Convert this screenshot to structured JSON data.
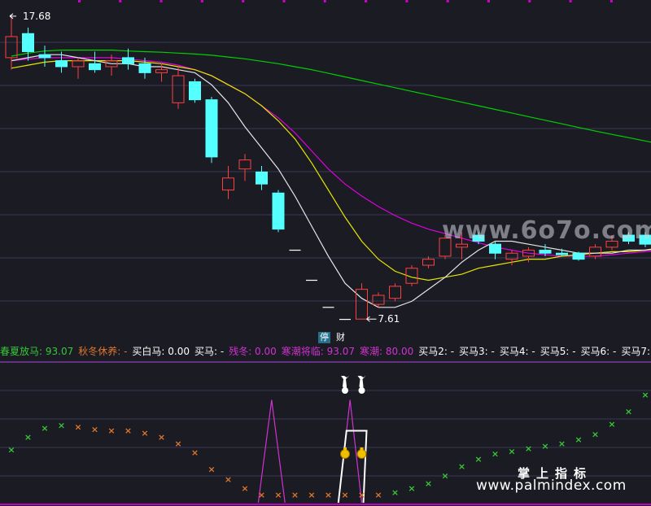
{
  "chart_data": [
    {
      "type": "candlestick",
      "title": "",
      "price_range": [
        7.4,
        18.0
      ],
      "grid": true,
      "high_label": "17.68",
      "low_label": "7.61",
      "candles": [
        {
          "o": 16.3,
          "h": 17.68,
          "l": 15.9,
          "c": 17.0
        },
        {
          "o": 17.1,
          "h": 17.3,
          "l": 16.2,
          "c": 16.5
        },
        {
          "o": 16.4,
          "h": 16.7,
          "l": 16.0,
          "c": 16.3
        },
        {
          "o": 16.2,
          "h": 16.5,
          "l": 15.8,
          "c": 16.0
        },
        {
          "o": 16.0,
          "h": 16.3,
          "l": 15.6,
          "c": 16.2
        },
        {
          "o": 16.1,
          "h": 16.5,
          "l": 15.8,
          "c": 15.9
        },
        {
          "o": 16.0,
          "h": 16.4,
          "l": 15.7,
          "c": 16.2
        },
        {
          "o": 16.3,
          "h": 16.6,
          "l": 15.9,
          "c": 16.1
        },
        {
          "o": 16.1,
          "h": 16.3,
          "l": 15.6,
          "c": 15.8
        },
        {
          "o": 15.8,
          "h": 16.1,
          "l": 15.5,
          "c": 15.9
        },
        {
          "o": 14.8,
          "h": 16.0,
          "l": 14.6,
          "c": 15.7
        },
        {
          "o": 15.5,
          "h": 15.6,
          "l": 14.8,
          "c": 14.9
        },
        {
          "o": 14.9,
          "h": 15.0,
          "l": 12.8,
          "c": 13.0
        },
        {
          "o": 11.9,
          "h": 12.7,
          "l": 11.6,
          "c": 12.3
        },
        {
          "o": 12.6,
          "h": 13.1,
          "l": 12.2,
          "c": 12.9
        },
        {
          "o": 12.5,
          "h": 12.7,
          "l": 11.9,
          "c": 12.1
        },
        {
          "o": 11.8,
          "h": 11.9,
          "l": 10.5,
          "c": 10.6
        },
        {
          "o": 9.9,
          "h": 9.9,
          "l": 9.9,
          "c": 9.9
        },
        {
          "o": 8.9,
          "h": 8.9,
          "l": 8.9,
          "c": 8.9
        },
        {
          "o": 8.0,
          "h": 8.0,
          "l": 8.0,
          "c": 8.0
        },
        {
          "o": 7.6,
          "h": 7.6,
          "l": 7.6,
          "c": 7.6
        },
        {
          "o": 7.61,
          "h": 8.8,
          "l": 7.61,
          "c": 8.6
        },
        {
          "o": 8.1,
          "h": 8.5,
          "l": 8.0,
          "c": 8.4
        },
        {
          "o": 8.3,
          "h": 8.8,
          "l": 8.2,
          "c": 8.7
        },
        {
          "o": 8.8,
          "h": 9.4,
          "l": 8.7,
          "c": 9.3
        },
        {
          "o": 9.4,
          "h": 9.7,
          "l": 9.3,
          "c": 9.6
        },
        {
          "o": 9.7,
          "h": 10.4,
          "l": 9.6,
          "c": 10.3
        },
        {
          "o": 10.0,
          "h": 10.5,
          "l": 9.6,
          "c": 10.1
        },
        {
          "o": 10.4,
          "h": 10.5,
          "l": 10.1,
          "c": 10.2
        },
        {
          "o": 10.1,
          "h": 10.2,
          "l": 9.6,
          "c": 9.8
        },
        {
          "o": 9.6,
          "h": 9.9,
          "l": 9.4,
          "c": 9.8
        },
        {
          "o": 9.7,
          "h": 10.0,
          "l": 9.5,
          "c": 9.9
        },
        {
          "o": 9.9,
          "h": 10.1,
          "l": 9.7,
          "c": 9.8
        },
        {
          "o": 9.8,
          "h": 9.95,
          "l": 9.7,
          "c": 9.75
        },
        {
          "o": 9.8,
          "h": 9.85,
          "l": 9.55,
          "c": 9.6
        },
        {
          "o": 9.7,
          "h": 10.1,
          "l": 9.6,
          "c": 10.0
        },
        {
          "o": 10.0,
          "h": 10.4,
          "l": 9.9,
          "c": 10.2
        },
        {
          "o": 10.4,
          "h": 10.5,
          "l": 10.1,
          "c": 10.2
        },
        {
          "o": 10.4,
          "h": 10.5,
          "l": 10.0,
          "c": 10.1
        },
        {
          "o": 10.1,
          "h": 10.3,
          "l": 9.9,
          "c": 10.2
        }
      ],
      "ma_white": [
        16.2,
        16.3,
        16.4,
        16.4,
        16.3,
        16.2,
        16.1,
        16.1,
        16.0,
        16.0,
        15.9,
        15.8,
        15.4,
        14.8,
        14.0,
        13.3,
        12.6,
        11.7,
        10.7,
        9.7,
        8.8,
        8.3,
        8.0,
        8.0,
        8.2,
        8.6,
        9.0,
        9.5,
        9.9,
        10.2,
        10.2,
        10.1,
        10.0,
        9.9,
        9.8,
        9.8,
        9.8,
        9.9,
        9.9,
        10.0
      ],
      "ma_yellow": [
        15.95,
        16.05,
        16.15,
        16.2,
        16.2,
        16.2,
        16.2,
        16.2,
        16.15,
        16.1,
        16.0,
        15.9,
        15.7,
        15.4,
        15.1,
        14.7,
        14.2,
        13.6,
        12.8,
        11.9,
        11.0,
        10.2,
        9.6,
        9.2,
        9.0,
        8.9,
        9.0,
        9.1,
        9.3,
        9.4,
        9.5,
        9.6,
        9.6,
        9.7,
        9.75,
        9.8,
        9.85,
        9.85,
        9.9,
        9.95
      ],
      "ma_magenta": [
        16.2,
        16.25,
        16.3,
        16.3,
        16.3,
        16.3,
        16.3,
        16.25,
        16.2,
        16.15,
        16.05,
        15.9,
        15.7,
        15.4,
        15.1,
        14.7,
        14.3,
        13.8,
        13.2,
        12.6,
        12.1,
        11.7,
        11.35,
        11.05,
        10.8,
        10.6,
        10.45,
        10.3,
        10.15,
        10.0,
        9.9,
        9.8,
        9.75,
        9.7,
        9.7,
        9.7,
        9.75,
        9.8,
        9.85,
        9.9
      ],
      "ma_green": [
        16.35,
        16.45,
        16.52,
        16.55,
        16.55,
        16.55,
        16.55,
        16.52,
        16.5,
        16.48,
        16.45,
        16.42,
        16.38,
        16.32,
        16.26,
        16.18,
        16.1,
        16.0,
        15.9,
        15.78,
        15.66,
        15.54,
        15.42,
        15.3,
        15.18,
        15.06,
        14.94,
        14.82,
        14.7,
        14.58,
        14.46,
        14.34,
        14.22,
        14.1,
        13.98,
        13.86,
        13.75,
        13.64,
        13.53,
        13.42
      ]
    },
    {
      "type": "indicator",
      "title": "",
      "range": [
        0,
        100
      ],
      "legend": [
        {
          "text": "春夏放马: 93.07",
          "color": "#37c837"
        },
        {
          "text": "秋冬休养: -",
          "color": "#e0762a"
        },
        {
          "text": "买白马: 0.00",
          "color": "#ffffff"
        },
        {
          "text": "买马: -",
          "color": "#ffffff"
        },
        {
          "text": "残冬: 0.00",
          "color": "#d033d0"
        },
        {
          "text": "寒潮将临: 93.07",
          "color": "#d033d0"
        },
        {
          "text": "寒潮: 80.00",
          "color": "#d033d0"
        },
        {
          "text": "买马2: -",
          "color": "#ffffff"
        },
        {
          "text": "买马3: -",
          "color": "#ffffff"
        },
        {
          "text": "买马4: -",
          "color": "#ffffff"
        },
        {
          "text": "买马5: -",
          "color": "#ffffff"
        },
        {
          "text": "买马6: -",
          "color": "#ffffff"
        },
        {
          "text": "买马7: -",
          "color": "#ffffff"
        }
      ],
      "x_markers": [
        {
          "v": 35,
          "color": "#37c837"
        },
        {
          "v": 45,
          "color": "#37c837"
        },
        {
          "v": 52,
          "color": "#37c837"
        },
        {
          "v": 54,
          "color": "#37c837"
        },
        {
          "v": 53,
          "color": "#e0762a"
        },
        {
          "v": 51,
          "color": "#e0762a"
        },
        {
          "v": 50,
          "color": "#e0762a"
        },
        {
          "v": 50,
          "color": "#e0762a"
        },
        {
          "v": 48,
          "color": "#e0762a"
        },
        {
          "v": 45,
          "color": "#e0762a"
        },
        {
          "v": 40,
          "color": "#e0762a"
        },
        {
          "v": 33,
          "color": "#e0762a"
        },
        {
          "v": 20,
          "color": "#e0762a"
        },
        {
          "v": 12,
          "color": "#e0762a"
        },
        {
          "v": 5,
          "color": "#e0762a"
        },
        {
          "v": 0,
          "color": "#e0762a"
        },
        {
          "v": 0,
          "color": "#e0762a"
        },
        {
          "v": 0,
          "color": "#e0762a"
        },
        {
          "v": 0,
          "color": "#e0762a"
        },
        {
          "v": 0,
          "color": "#e0762a"
        },
        {
          "v": 0,
          "color": "#e0762a"
        },
        {
          "v": 0,
          "color": "#e0762a"
        },
        {
          "v": 0,
          "color": "#e0762a"
        },
        {
          "v": 2,
          "color": "#37c837"
        },
        {
          "v": 5,
          "color": "#37c837"
        },
        {
          "v": 9,
          "color": "#37c837"
        },
        {
          "v": 15,
          "color": "#37c837"
        },
        {
          "v": 22,
          "color": "#37c837"
        },
        {
          "v": 28,
          "color": "#37c837"
        },
        {
          "v": 32,
          "color": "#37c837"
        },
        {
          "v": 34,
          "color": "#37c837"
        },
        {
          "v": 36,
          "color": "#37c837"
        },
        {
          "v": 38,
          "color": "#37c837"
        },
        {
          "v": 40,
          "color": "#37c837"
        },
        {
          "v": 43,
          "color": "#37c837"
        },
        {
          "v": 47,
          "color": "#37c837"
        },
        {
          "v": 55,
          "color": "#37c837"
        },
        {
          "v": 65,
          "color": "#37c837"
        },
        {
          "v": 78,
          "color": "#37c837"
        },
        {
          "v": 93.07,
          "color": "#37c837"
        }
      ],
      "peaks": [
        {
          "start": 14.8,
          "top": 15.6,
          "end": 16.4,
          "value": 80,
          "color": "#d033d0"
        },
        {
          "start": 19.6,
          "top": 20.3,
          "end": 21.0,
          "value": 80,
          "color": "#d033d0"
        },
        {
          "start": 19.6,
          "top": 20.3,
          "end": 21.1,
          "value": 56,
          "color": "#ffffff",
          "flat_to": 21.0
        }
      ],
      "icons": [
        {
          "at": 20.0,
          "icon": "money-bag-icon"
        },
        {
          "at": 21.0,
          "icon": "money-bag-icon"
        },
        {
          "at": 20.0,
          "icon": "horse-head-icon"
        },
        {
          "at": 21.0,
          "icon": "horse-head-icon"
        }
      ]
    }
  ],
  "tags": {
    "stop": "停",
    "cai": "财"
  },
  "watermarks": {
    "site_6070": "www.6o7o.com",
    "palm_cn": "掌上指标",
    "palm_url": "www.palmindex.com"
  },
  "colors": {
    "up": "#ff4040",
    "down": "#54ffff",
    "ma_white": "#e6e6e6",
    "ma_yellow": "#e6e600",
    "ma_magenta": "#e000e0",
    "ma_green": "#00d000",
    "grid": "#3a3a55",
    "separator": "#7a3aa0"
  }
}
